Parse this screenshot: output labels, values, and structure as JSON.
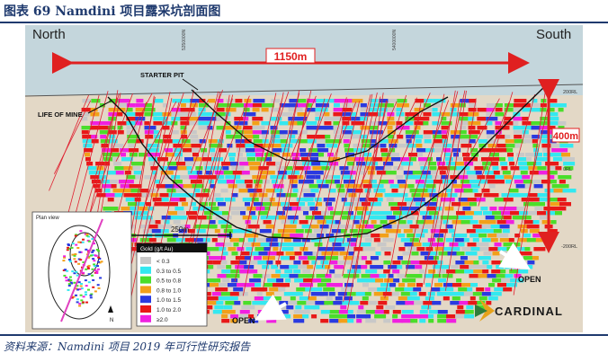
{
  "caption": {
    "title": "图表 69  Namdini 项目露采坑剖面图",
    "source": "资料来源：Namdini 项目 2019 年可行性研究报告"
  },
  "section": {
    "north_label": "North",
    "south_label": "South",
    "grid_label_1": "5350000N",
    "grid_label_2": "5400000N",
    "width_label": "1150m",
    "depth_label": "400m",
    "starter_pit_label": "STARTER PIT",
    "life_of_mine_label": "LIFE OF MINE",
    "rl_labels": [
      "200RL",
      "0RL",
      "-200RL"
    ],
    "open_label_1": "OPEN",
    "open_label_2": "OPEN",
    "scale_label": "250m",
    "plan_view_label": "Plan view",
    "north_arrow_label": "N",
    "brand": "CARDINAL"
  },
  "legend": {
    "title": "Gold (g/t Au)",
    "items": [
      {
        "label": "< 0.3",
        "color": "#c8c8c8"
      },
      {
        "label": "0.3 to 0.5",
        "color": "#33e8f0"
      },
      {
        "label": "0.5 to 0.8",
        "color": "#4ade2a"
      },
      {
        "label": "0.8 to 1.0",
        "color": "#f2a019"
      },
      {
        "label": "1.0 to 1.5",
        "color": "#2a3ae0"
      },
      {
        "label": "1.0 to 2.0",
        "color": "#e81818"
      },
      {
        "label": "≥2.0",
        "color": "#f020e0"
      }
    ]
  },
  "colors": {
    "sky": "#c4d6dc",
    "ground": "#e3d8c6",
    "arrow_red": "#e02020",
    "pit_line": "#111111",
    "caption_blue": "#1f3a6e"
  }
}
